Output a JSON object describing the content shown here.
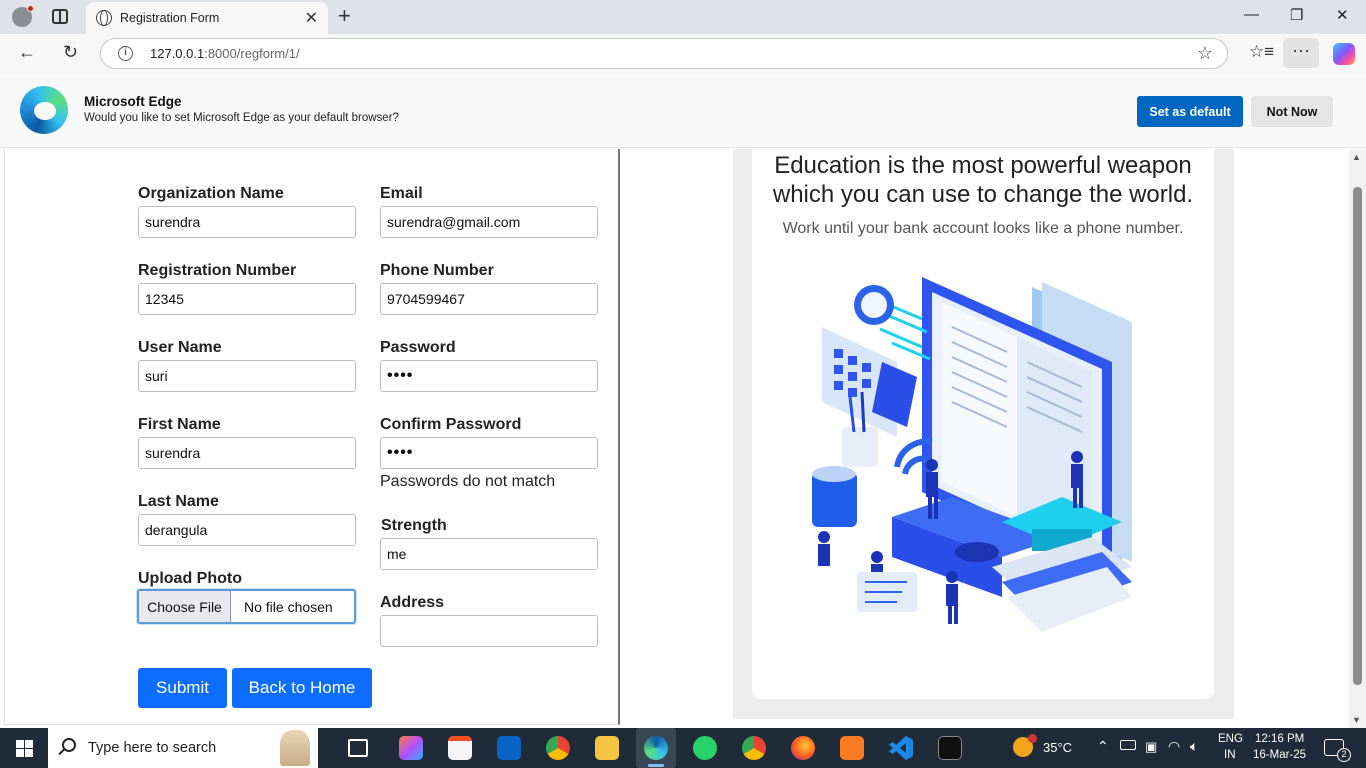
{
  "browser": {
    "tab": {
      "title": "Registration Form"
    },
    "address": {
      "host": "127.0.0.1",
      "rest": ":8000/regform/1/"
    }
  },
  "banner": {
    "title": "Microsoft Edge",
    "message": "Would you like to set Microsoft Edge as your default browser?",
    "primary": "Set as default",
    "secondary": "Not Now"
  },
  "form": {
    "left": [
      {
        "label": "Organization Name",
        "value": "surendra"
      },
      {
        "label": "Registration Number",
        "value": "12345"
      },
      {
        "label": "User Name",
        "value": "suri"
      },
      {
        "label": "First Name",
        "value": "surendra"
      },
      {
        "label": "Last Name",
        "value": "derangula"
      }
    ],
    "right": [
      {
        "label": "Email",
        "value": "surendra@gmail.com"
      },
      {
        "label": "Phone Number",
        "value": "9704599467"
      },
      {
        "label": "Password",
        "value": "••••"
      },
      {
        "label": "Confirm Password",
        "value": "••••"
      },
      {
        "label": "Strength",
        "value": "me"
      },
      {
        "label": "Address",
        "value": ""
      }
    ],
    "password_error": "Passwords do not match",
    "upload": {
      "label": "Upload Photo",
      "button": "Choose File",
      "status": "No file chosen"
    },
    "submit": "Submit",
    "back": "Back to Home"
  },
  "hero": {
    "quote": "Education is the most powerful weapon which you can use to change the world.",
    "subquote": "Work until your bank account looks like a phone number."
  },
  "taskbar": {
    "search_placeholder": "Type here to search",
    "weather": "35°C",
    "lang_top": "ENG",
    "lang_bottom": "IN",
    "time": "12:16 PM",
    "date": "16-Mar-25",
    "notifications": "2"
  },
  "colors": {
    "primary_button": "#0d6efd",
    "edge_button": "#0067c0",
    "taskbar": "#1f2b38"
  }
}
